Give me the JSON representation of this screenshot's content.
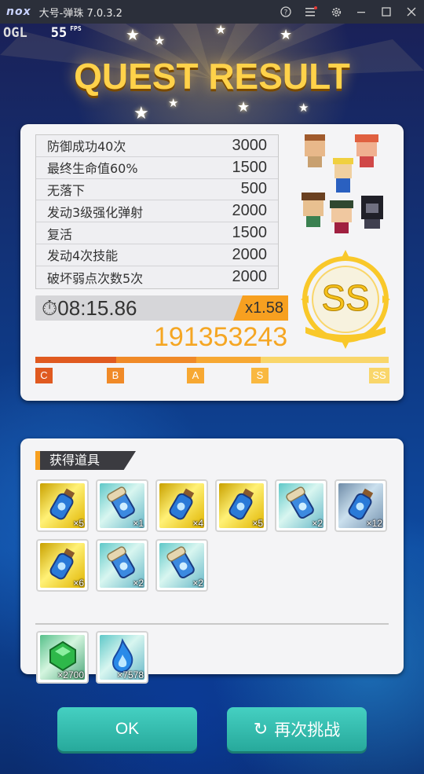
{
  "window": {
    "logo": "nox",
    "title": "大号-弹珠 7.0.3.2",
    "icons": [
      "help-icon",
      "menu-icon",
      "gear-icon",
      "minimize-icon",
      "maximize-icon",
      "close-icon"
    ]
  },
  "hud": {
    "ogl": "OGL",
    "fps_value": "55",
    "fps_unit": "FPS"
  },
  "result": {
    "title": "QUEST RESULT",
    "bonuses": [
      {
        "label": "防御成功40次",
        "points": "3000"
      },
      {
        "label": "最终生命值60%",
        "points": "1500"
      },
      {
        "label": "无落下",
        "points": "500"
      },
      {
        "label": "发动3级强化弹射",
        "points": "2000"
      },
      {
        "label": "复活",
        "points": "1500"
      },
      {
        "label": "发动4次技能",
        "points": "2000"
      },
      {
        "label": "破坏弱点次数5次",
        "points": "2000"
      }
    ],
    "time": "08:15.86",
    "multiplier": "x1.58",
    "score": "191353243",
    "rank": "SS",
    "rank_ticks": [
      "C",
      "B",
      "A",
      "S",
      "SS"
    ],
    "colors": {
      "accent": "#f7a020",
      "rank_gold": "#f9d66a",
      "rank_orange": "#e05a20"
    }
  },
  "items": {
    "header": "获得道具",
    "row_items": [
      {
        "bg": "gold",
        "icon": "potion-icon",
        "count": "×5"
      },
      {
        "bg": "cyan",
        "icon": "scroll-bottle-icon",
        "count": "×1"
      },
      {
        "bg": "gold",
        "icon": "potion-icon",
        "count": "×4"
      },
      {
        "bg": "gold",
        "icon": "potion-icon",
        "count": "×5"
      },
      {
        "bg": "cyan",
        "icon": "scroll-bottle-icon",
        "count": "×2"
      },
      {
        "bg": "steel",
        "icon": "potion-icon",
        "count": "×12"
      },
      {
        "bg": "gold",
        "icon": "potion-icon",
        "count": "×6"
      },
      {
        "bg": "cyan",
        "icon": "scroll-bottle-icon",
        "count": "×2"
      },
      {
        "bg": "cyan",
        "icon": "scroll-bottle-icon",
        "count": "×2"
      }
    ],
    "currency": [
      {
        "bg": "green",
        "icon": "green-gem-icon",
        "count": "×2700"
      },
      {
        "bg": "cyan",
        "icon": "blue-flame-icon",
        "count": "×7578"
      }
    ]
  },
  "buttons": {
    "ok": "OK",
    "retry": "再次挑战"
  }
}
